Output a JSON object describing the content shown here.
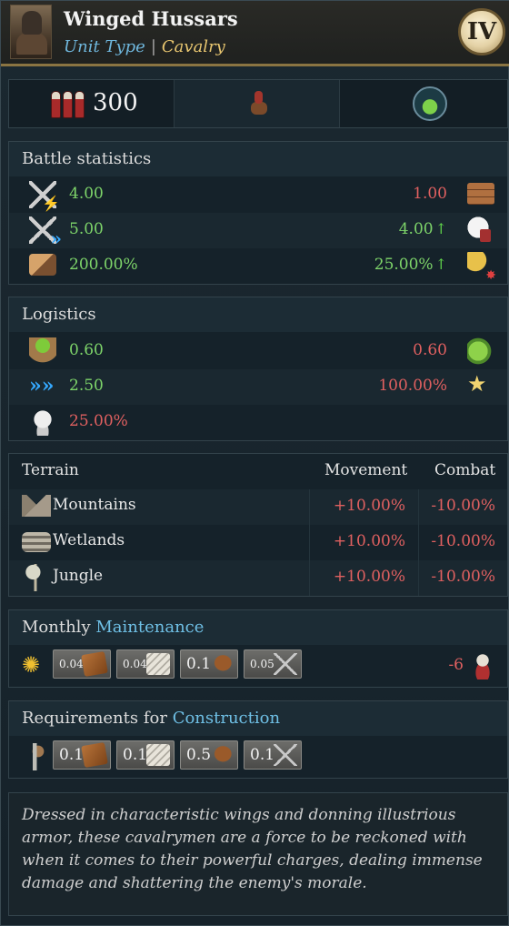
{
  "unit": {
    "name": "Winged Hussars",
    "type_label": "Unit Type",
    "class_label": "Cavalry",
    "tier": "IV"
  },
  "strip": {
    "manpower": "300"
  },
  "battle_statistics": {
    "heading": "Battle statistics",
    "rows": [
      {
        "left_icon": "melee-lightning-icon",
        "left": "4.00",
        "right": "1.00",
        "right_icon": "bricks-icon",
        "right_arrow": ""
      },
      {
        "left_icon": "melee-speed-icon",
        "left": "5.00",
        "right": "4.00",
        "right_icon": "wing-icon",
        "right_arrow": "↑"
      },
      {
        "left_icon": "charge-icon",
        "left": "200.00%",
        "right": "25.00%",
        "right_icon": "horn-icon",
        "right_arrow": "↑"
      }
    ]
  },
  "logistics": {
    "heading": "Logistics",
    "rows": [
      {
        "left_icon": "food-sack-icon",
        "left": "0.60",
        "right": "0.60",
        "right_icon": "greens-icon"
      },
      {
        "left_icon": "speed-icon",
        "left": "2.50",
        "right": "100.00%",
        "right_icon": "star-icon"
      },
      {
        "left_icon": "skull-icon",
        "left": "25.00%",
        "right": "",
        "right_icon": ""
      }
    ]
  },
  "terrain": {
    "header": {
      "terrain": "Terrain",
      "movement": "Movement",
      "combat": "Combat"
    },
    "rows": [
      {
        "icon": "mountains-icon",
        "name": "Mountains",
        "movement": "+10.00%",
        "combat": "-10.00%"
      },
      {
        "icon": "wetlands-icon",
        "name": "Wetlands",
        "movement": "+10.00%",
        "combat": "-10.00%"
      },
      {
        "icon": "jungle-icon",
        "name": "Jungle",
        "movement": "+10.00%",
        "combat": "-10.00%"
      }
    ]
  },
  "maintenance": {
    "heading_prefix": "Monthly",
    "heading_highlight": "Maintenance",
    "items": [
      {
        "amount": "0.04",
        "icon": "leather-icon"
      },
      {
        "amount": "0.04",
        "icon": "cloth-icon"
      },
      {
        "amount": "0.1",
        "icon": "horse-icon"
      },
      {
        "amount": "0.05",
        "icon": "spears-icon"
      }
    ],
    "manpower_change": "-6"
  },
  "construction": {
    "heading_prefix": "Requirements for",
    "heading_highlight": "Construction",
    "items": [
      {
        "amount": "0.1",
        "icon": "leather-icon"
      },
      {
        "amount": "0.1",
        "icon": "cloth-icon"
      },
      {
        "amount": "0.5",
        "icon": "horse-icon"
      },
      {
        "amount": "0.1",
        "icon": "spears-icon"
      }
    ]
  },
  "description": "Dressed in characteristic wings and donning illustrious armor, these cavalrymen are a force to be reckoned with when it comes to their powerful charges, dealing immense damage and shattering the enemy's morale."
}
